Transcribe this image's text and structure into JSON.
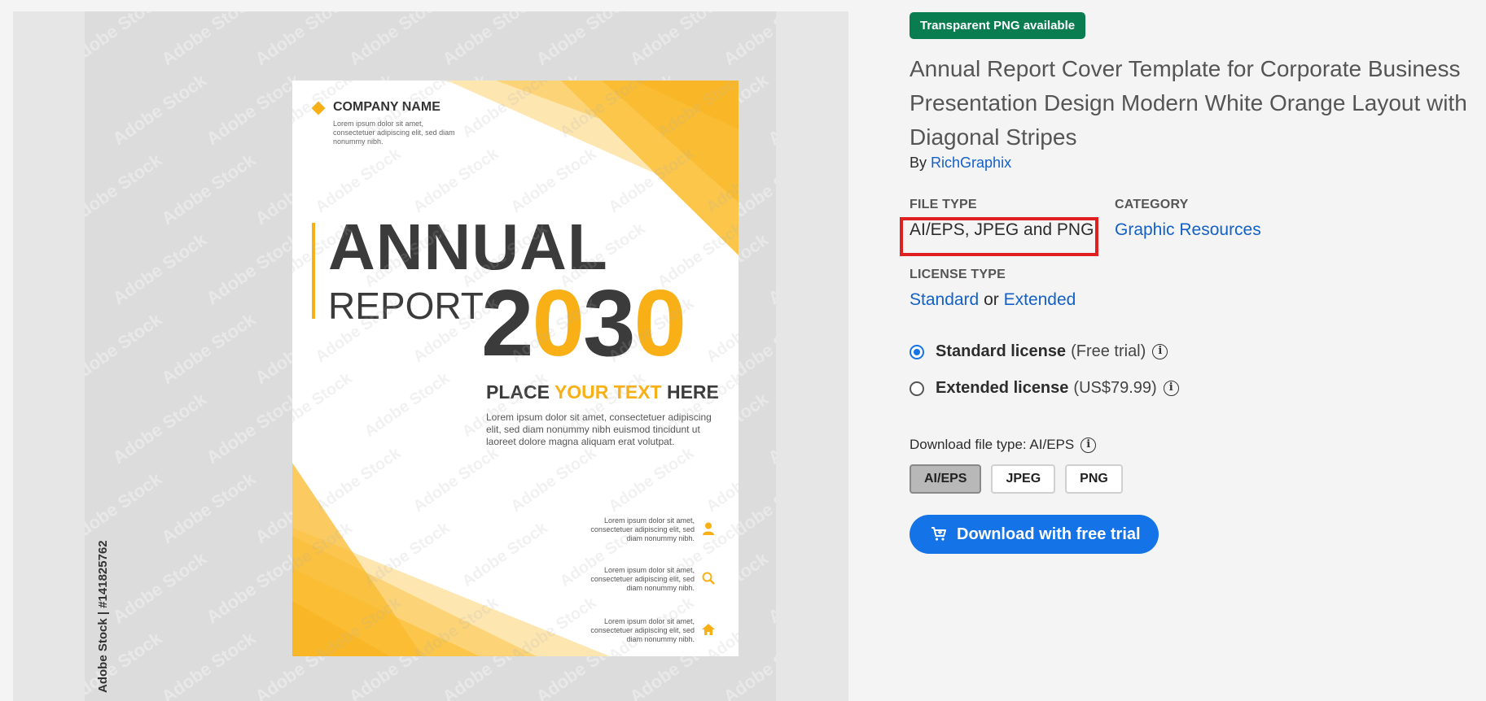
{
  "preview": {
    "side_credit": "Adobe Stock | #141825762",
    "watermark_text": "Adobe Stock",
    "poster": {
      "company_name": "COMPANY NAME",
      "company_desc": "Lorem ipsum dolor sit amet, consectetuer adipiscing elit, sed diam nonummy nibh.",
      "annual": "ANNUAL",
      "report": "REPORT",
      "year_digits": [
        "2",
        "0",
        "3",
        "0"
      ],
      "place_1": "PLACE",
      "place_2": "YOUR TEXT",
      "place_3": "HERE",
      "body_text": "Lorem ipsum dolor sit amet, consectetuer adipiscing elit, sed diam nonummy nibh euismod tincidunt ut laoreet dolore magna aliquam erat volutpat.",
      "info_rows": [
        {
          "text": "Lorem ipsum dolor sit amet, consectetuer adipiscing elit, sed diam nonummy nibh.",
          "icon": "user-icon"
        },
        {
          "text": "Lorem ipsum dolor sit amet, consectetuer adipiscing elit, sed diam nonummy nibh.",
          "icon": "search-icon"
        },
        {
          "text": "Lorem ipsum dolor sit amet, consectetuer adipiscing elit, sed diam nonummy nibh.",
          "icon": "home-icon"
        }
      ]
    }
  },
  "details": {
    "badge": "Transparent PNG available",
    "title": "Annual Report Cover Template for Corporate Business Presentation Design Modern White Orange Layout with Diagonal Stripes",
    "by_label": "By",
    "author": "RichGraphix",
    "file_type_label": "FILE TYPE",
    "file_type_value": "AI/EPS, JPEG and PNG",
    "category_label": "CATEGORY",
    "category_value": "Graphic Resources",
    "license_type_label": "LICENSE TYPE",
    "license_standard": "Standard",
    "license_or": "or",
    "license_extended": "Extended",
    "standard_license": "Standard license",
    "standard_note": "(Free trial)",
    "extended_license": "Extended license",
    "extended_note": "(US$79.99)",
    "download_type_label": "Download file type: AI/EPS",
    "file_options": [
      "AI/EPS",
      "JPEG",
      "PNG"
    ],
    "selected_option": "AI/EPS",
    "cta": "Download with free trial"
  },
  "colors": {
    "accent_orange": "#f8b016",
    "brand_blue": "#1473e6",
    "badge_green": "#0a7d50",
    "highlight_red": "#e02020"
  }
}
